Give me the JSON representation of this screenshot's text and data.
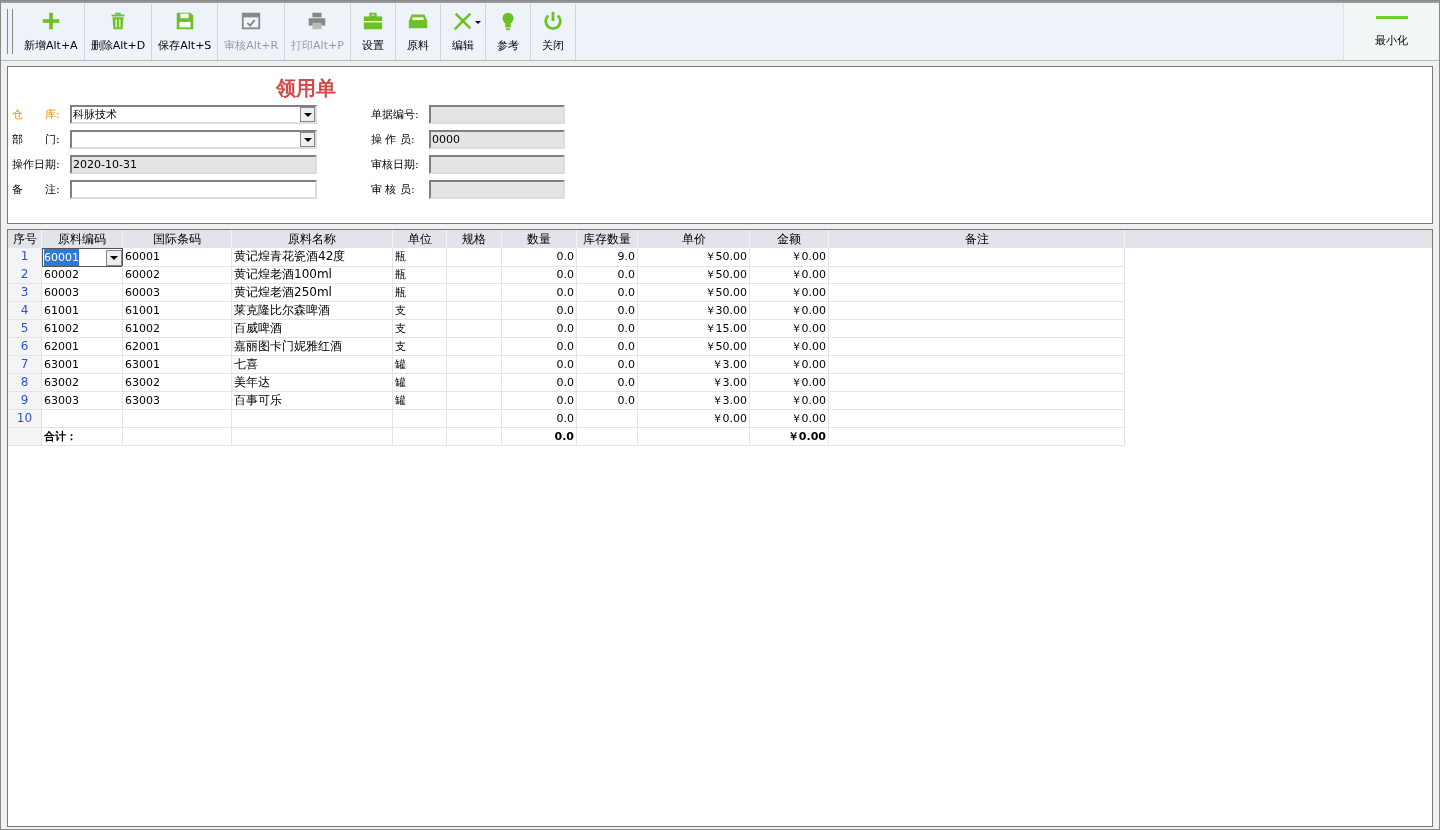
{
  "toolbar": {
    "buttons": [
      {
        "kind": "add",
        "label": "新增Alt+A",
        "disabled": false
      },
      {
        "kind": "delete",
        "label": "删除Alt+D",
        "disabled": false
      },
      {
        "kind": "save",
        "label": "保存Alt+S",
        "disabled": false
      },
      {
        "kind": "audit",
        "label": "审核Alt+R",
        "disabled": true
      },
      {
        "kind": "print",
        "label": "打印Alt+P",
        "disabled": true
      },
      {
        "kind": "settings",
        "label": "设置",
        "disabled": false
      },
      {
        "kind": "material",
        "label": "原料",
        "disabled": false
      },
      {
        "kind": "edit",
        "label": "编辑",
        "disabled": false
      },
      {
        "kind": "reference",
        "label": "参考",
        "disabled": false
      },
      {
        "kind": "close",
        "label": "关闭",
        "disabled": false
      }
    ],
    "minimize": {
      "label": "最小化"
    }
  },
  "form": {
    "title": "领用单",
    "left_fields": [
      {
        "label": "仓　　库:",
        "kind": "combo",
        "value": "科脉技术",
        "readonly": false,
        "highlighted": true
      },
      {
        "label": "部　　门:",
        "kind": "combo",
        "readonly": false,
        "highlighted": false
      },
      {
        "label": "操作日期:",
        "kind": "text",
        "value": "2020-10-31",
        "readonly": true,
        "highlighted": false
      },
      {
        "label": "备　　注:",
        "kind": "text",
        "readonly": false,
        "highlighted": false
      }
    ],
    "right_fields": [
      {
        "label": "单据编号:",
        "readonly": true,
        "highlighted": false
      },
      {
        "label": "操 作 员:",
        "value": "0000",
        "readonly": true,
        "highlighted": false
      },
      {
        "label": "审核日期:",
        "readonly": true,
        "highlighted": false
      },
      {
        "label": "审 核 员:",
        "readonly": true,
        "highlighted": false
      }
    ]
  },
  "table": {
    "columns": [
      "序号",
      "原料编码",
      "国际条码",
      "原料名称",
      "单位",
      "规格",
      "数量",
      "库存数量",
      "单价",
      "金额",
      "备注"
    ],
    "rows": [
      {
        "no": "1",
        "code": "60001",
        "barcode": "60001",
        "name": "黄记煌青花瓷酒42度",
        "unit": "瓶",
        "qty": "0.0",
        "stock": "9.0",
        "price": "￥50.00",
        "amount": "￥0.00",
        "selected": true
      },
      {
        "no": "2",
        "code": "60002",
        "barcode": "60002",
        "name": "黄记煌老酒100ml",
        "unit": "瓶",
        "qty": "0.0",
        "stock": "0.0",
        "price": "￥50.00",
        "amount": "￥0.00",
        "selected": false
      },
      {
        "no": "3",
        "code": "60003",
        "barcode": "60003",
        "name": "黄记煌老酒250ml",
        "unit": "瓶",
        "qty": "0.0",
        "stock": "0.0",
        "price": "￥50.00",
        "amount": "￥0.00",
        "selected": false
      },
      {
        "no": "4",
        "code": "61001",
        "barcode": "61001",
        "name": "莱克隆比尔森啤酒",
        "unit": "支",
        "qty": "0.0",
        "stock": "0.0",
        "price": "￥30.00",
        "amount": "￥0.00",
        "selected": false
      },
      {
        "no": "5",
        "code": "61002",
        "barcode": "61002",
        "name": "百威啤酒",
        "unit": "支",
        "qty": "0.0",
        "stock": "0.0",
        "price": "￥15.00",
        "amount": "￥0.00",
        "selected": false
      },
      {
        "no": "6",
        "code": "62001",
        "barcode": "62001",
        "name": "嘉丽图卡门妮雅红酒",
        "unit": "支",
        "qty": "0.0",
        "stock": "0.0",
        "price": "￥50.00",
        "amount": "￥0.00",
        "selected": false
      },
      {
        "no": "7",
        "code": "63001",
        "barcode": "63001",
        "name": "七喜",
        "unit": "罐",
        "qty": "0.0",
        "stock": "0.0",
        "price": "￥3.00",
        "amount": "￥0.00",
        "selected": false
      },
      {
        "no": "8",
        "code": "63002",
        "barcode": "63002",
        "name": "美年达",
        "unit": "罐",
        "qty": "0.0",
        "stock": "0.0",
        "price": "￥3.00",
        "amount": "￥0.00",
        "selected": false
      },
      {
        "no": "9",
        "code": "63003",
        "barcode": "63003",
        "name": "百事可乐",
        "unit": "罐",
        "qty": "0.0",
        "stock": "0.0",
        "price": "￥3.00",
        "amount": "￥0.00",
        "selected": false
      },
      {
        "no": "10",
        "qty": "0.0",
        "price": "￥0.00",
        "amount": "￥0.00",
        "selected": false
      }
    ],
    "total": {
      "label": "合计：",
      "qty": "0.0",
      "amount": "￥0.00"
    }
  }
}
